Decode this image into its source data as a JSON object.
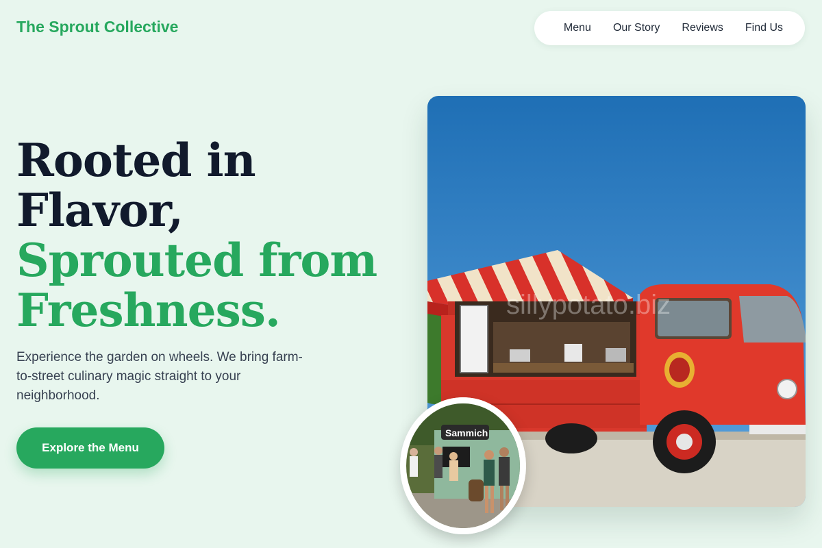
{
  "brand": {
    "name": "The Sprout Collective"
  },
  "nav": {
    "items": [
      "Menu",
      "Our Story",
      "Reviews",
      "Find Us"
    ]
  },
  "hero": {
    "headline_dark": [
      "Rooted in",
      "Flavor,"
    ],
    "headline_green": [
      "Sprouted from",
      "Freshness."
    ],
    "lede": "Experience the garden on wheels. We bring farm-to-street culinary magic straight to your neighborhood.",
    "cta_label": "Explore the Menu"
  },
  "images": {
    "main_photo": {
      "watermark": "sillypotato.biz"
    },
    "thumb_photo": {
      "sign_text": "Sammich"
    }
  },
  "colors": {
    "accent": "#27a85e",
    "background": "#e8f6ee",
    "heading": "#111a2c",
    "body_text": "#374151",
    "truck_red": "#e0392b"
  }
}
